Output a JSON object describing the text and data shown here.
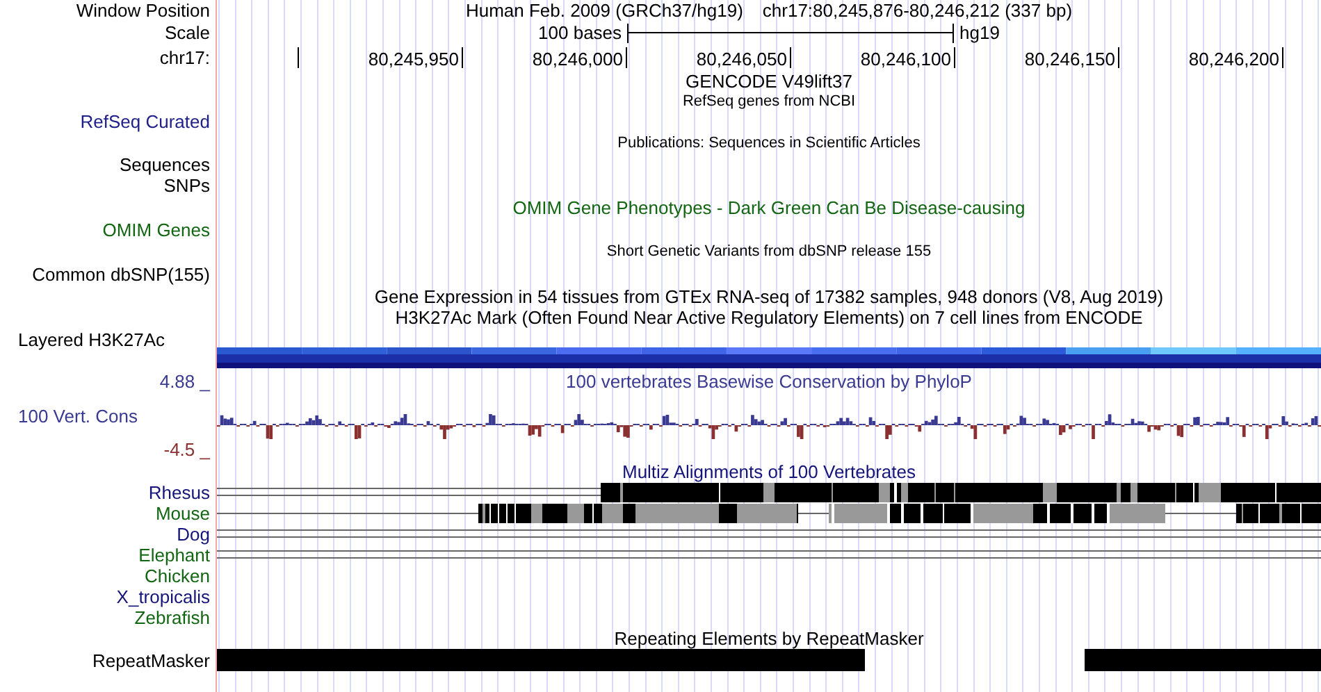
{
  "rows": [
    {
      "kind": "text",
      "label": "Window Position",
      "titles": [
        "Human Feb. 2009 (GRCh37/hg19)",
        "chr17:80,245,876-80,246,212 (337 bp)"
      ]
    },
    {
      "kind": "scale",
      "label": "Scale",
      "scale_text": "100 bases",
      "assembly": "hg19"
    },
    {
      "kind": "ruler",
      "label": "chr17:",
      "ticks": [
        "80,245,950",
        "80,246,000",
        "80,246,050",
        "80,246,100",
        "80,246,150",
        "80,246,200"
      ]
    },
    {
      "kind": "text",
      "titles": [
        "GENCODE V49lift37"
      ]
    },
    {
      "kind": "text",
      "titles": [
        "RefSeq genes from NCBI"
      ],
      "small": true
    },
    {
      "kind": "text",
      "label": "RefSeq Curated",
      "color": "#1f1f8a"
    },
    {
      "kind": "text",
      "titles": [
        "Publications: Sequences in Scientific Articles"
      ],
      "small": true
    },
    {
      "kind": "text",
      "label": "Sequences"
    },
    {
      "kind": "text",
      "label": "SNPs"
    },
    {
      "kind": "text",
      "titles": [
        "OMIM Gene Phenotypes - Dark Green Can Be Disease-causing"
      ],
      "color": "#126612"
    },
    {
      "kind": "text",
      "label": "OMIM Genes",
      "color": "#126612"
    },
    {
      "kind": "text",
      "titles": [
        "Short Genetic Variants from dbSNP release 155"
      ],
      "small": true
    },
    {
      "kind": "text",
      "label": "Common dbSNP(155)"
    },
    {
      "kind": "text",
      "titles": [
        "Gene Expression in 54 tissues from GTEx RNA-seq of 17382 samples, 948 donors (V8, Aug 2019)"
      ]
    },
    {
      "kind": "text",
      "titles": [
        "H3K27Ac Mark (Often Found Near Active Regulatory Elements) on 7 cell lines from ENCODE"
      ]
    },
    {
      "kind": "band",
      "label": "Layered H3K27Ac"
    },
    {
      "kind": "text",
      "label": "4.88 _",
      "titles": [
        "100 vertebrates Basewise Conservation by PhyloP"
      ],
      "color": "#3a3a92"
    },
    {
      "kind": "wiggle",
      "label": "100 Vert. Cons",
      "color": "#3a3a92"
    },
    {
      "kind": "text",
      "label": "-4.5 _",
      "color": "#8a3030"
    },
    {
      "kind": "text",
      "titles": [
        "Multiz Alignments of 100 Vertebrates"
      ],
      "color": "#14147a"
    },
    {
      "kind": "paired",
      "label": "Rhesus",
      "color": "#14147a",
      "blocks": true
    },
    {
      "kind": "single",
      "label": "Mouse",
      "color": "#126612",
      "blocks": true
    },
    {
      "kind": "paired",
      "label": "Dog",
      "color": "#14147a",
      "blocks": false
    },
    {
      "kind": "paired",
      "label": "Elephant",
      "color": "#126612",
      "blocks": false
    },
    {
      "kind": "empty",
      "label": "Chicken",
      "color": "#126612",
      "blocks": false
    },
    {
      "kind": "empty",
      "label": "X_tropicalis",
      "color": "#14147a",
      "blocks": false
    },
    {
      "kind": "empty",
      "label": "Zebrafish",
      "color": "#126612",
      "blocks": false
    },
    {
      "kind": "text",
      "titles": [
        "Repeating Elements by RepeatMasker"
      ]
    },
    {
      "kind": "repeats",
      "label": "RepeatMasker"
    }
  ]
}
